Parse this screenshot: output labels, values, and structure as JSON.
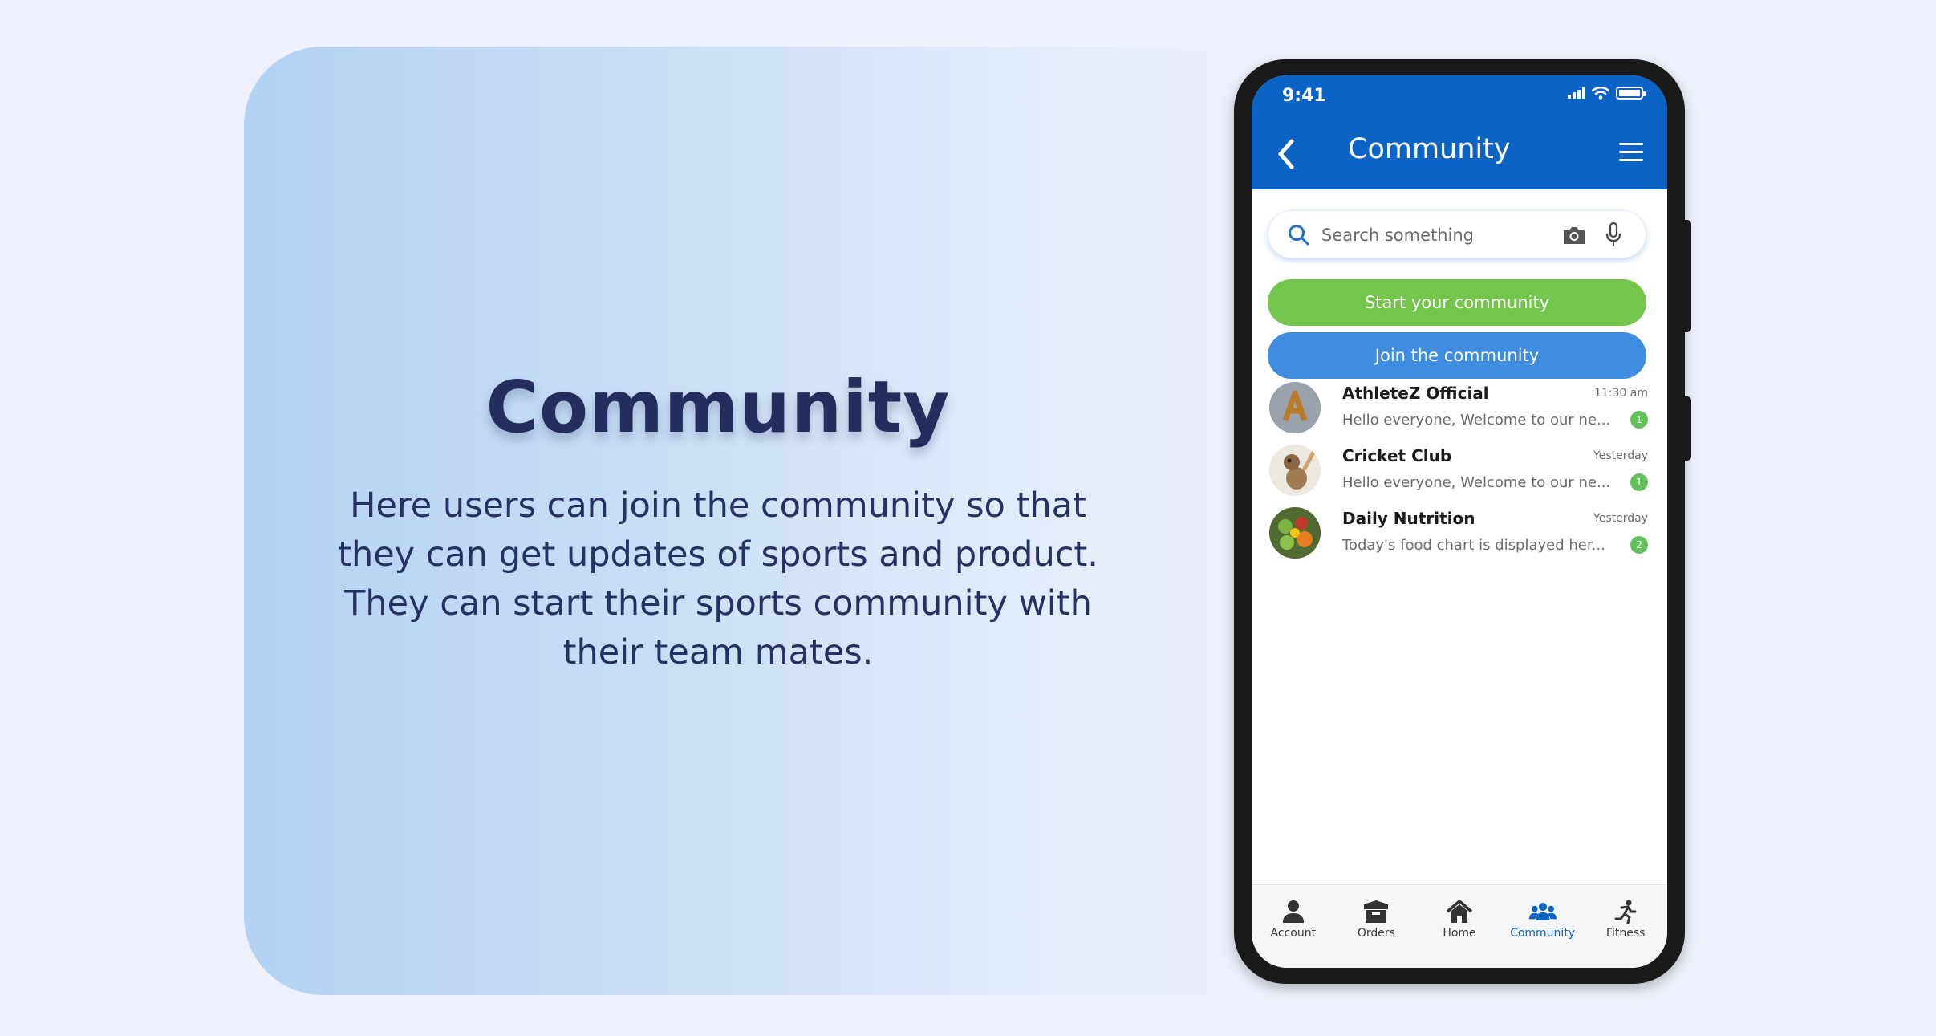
{
  "hero": {
    "title": "Community",
    "description": "Here users can join the community so that they can get updates of sports and product. They can start their sports community with their team mates."
  },
  "phone": {
    "status_time": "9:41",
    "header_title": "Community",
    "search": {
      "placeholder": "Search something"
    },
    "buttons": {
      "start": "Start your community",
      "join": "Join the community"
    },
    "chats": [
      {
        "name": "AthleteZ Official",
        "time": "11:30 am",
        "message": "Hello everyone, Welcome to our ne...",
        "unread": "1"
      },
      {
        "name": "Cricket Club",
        "time": "Yesterday",
        "message": "Hello everyone, Welcome to our ne...",
        "unread": "1"
      },
      {
        "name": "Daily Nutrition",
        "time": "Yesterday",
        "message": "Today's food chart is displayed her...",
        "unread": "2"
      }
    ],
    "nav": [
      {
        "label": "Account",
        "icon": "person-icon"
      },
      {
        "label": "Orders",
        "icon": "box-icon"
      },
      {
        "label": "Home",
        "icon": "home-icon"
      },
      {
        "label": "Community",
        "icon": "users-icon"
      },
      {
        "label": "Fitness",
        "icon": "running-icon"
      }
    ]
  },
  "colors": {
    "brand_blue": "#0c63c6",
    "start_green": "#74c54c",
    "join_blue": "#3e8de0",
    "badge_green": "#62c15a",
    "hero_text": "#242e5e"
  }
}
